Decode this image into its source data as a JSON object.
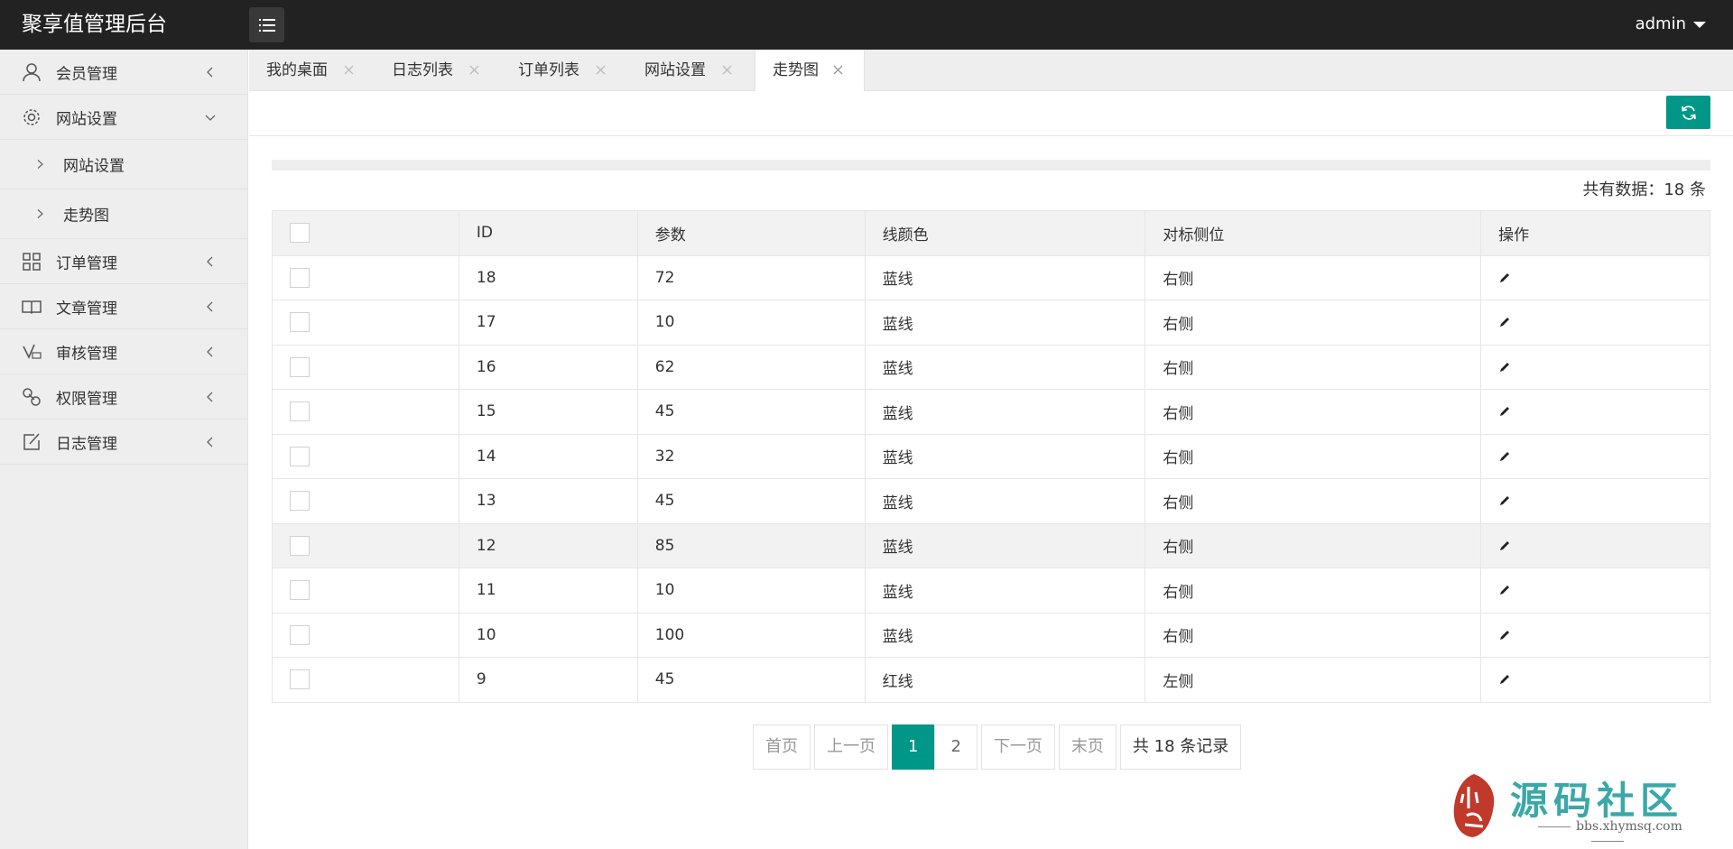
{
  "header": {
    "title": "聚享值管理后台",
    "user": "admin"
  },
  "sidebar": {
    "items": [
      {
        "label": "会员管理"
      },
      {
        "label": "网站设置"
      },
      {
        "label": "订单管理"
      },
      {
        "label": "文章管理"
      },
      {
        "label": "审核管理"
      },
      {
        "label": "权限管理"
      },
      {
        "label": "日志管理"
      }
    ],
    "subitems": [
      {
        "label": "网站设置"
      },
      {
        "label": "走势图"
      }
    ]
  },
  "tabs": [
    {
      "label": "我的桌面"
    },
    {
      "label": "日志列表"
    },
    {
      "label": "订单列表"
    },
    {
      "label": "网站设置"
    },
    {
      "label": "走势图",
      "active": true
    }
  ],
  "summary": {
    "total": "共有数据：18 条"
  },
  "table": {
    "headers": [
      "ID",
      "参数",
      "线颜色",
      "对标侧位",
      "操作"
    ],
    "rows": [
      {
        "id": "18",
        "param": "72",
        "color": "蓝线",
        "side": "右侧"
      },
      {
        "id": "17",
        "param": "10",
        "color": "蓝线",
        "side": "右侧"
      },
      {
        "id": "16",
        "param": "62",
        "color": "蓝线",
        "side": "右侧"
      },
      {
        "id": "15",
        "param": "45",
        "color": "蓝线",
        "side": "右侧"
      },
      {
        "id": "14",
        "param": "32",
        "color": "蓝线",
        "side": "右侧"
      },
      {
        "id": "13",
        "param": "45",
        "color": "蓝线",
        "side": "右侧"
      },
      {
        "id": "12",
        "param": "85",
        "color": "蓝线",
        "side": "右侧"
      },
      {
        "id": "11",
        "param": "10",
        "color": "蓝线",
        "side": "右侧"
      },
      {
        "id": "10",
        "param": "100",
        "color": "蓝线",
        "side": "右侧"
      },
      {
        "id": "9",
        "param": "45",
        "color": "红线",
        "side": "左侧"
      }
    ]
  },
  "pagination": {
    "first": "首页",
    "prev": "上一页",
    "pages": [
      "1",
      "2"
    ],
    "current": "1",
    "next": "下一页",
    "last": "末页",
    "info": "共 18 条记录"
  },
  "watermark": {
    "title": "源码社区",
    "url": "bbs.xhymsq.com"
  },
  "colors": {
    "header": "#222222",
    "sidebar": "#eeeeee",
    "accent": "#009688"
  }
}
